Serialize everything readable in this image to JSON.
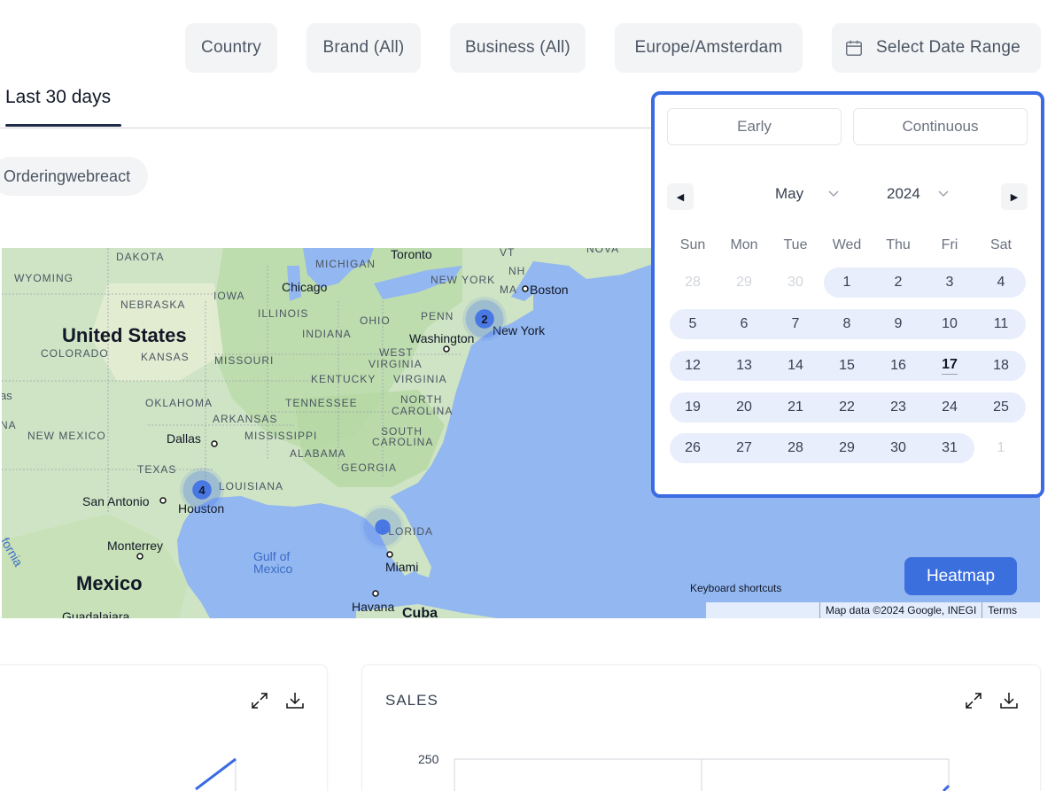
{
  "filters": {
    "country": "Country",
    "brand": "Brand (All)",
    "business": "Business (All)",
    "timezone": "Europe/Amsterdam",
    "date_range": "Select Date Range",
    "date_icon": "calendar-icon"
  },
  "tabs": [
    {
      "label": "Last 30 days",
      "active": true
    }
  ],
  "chip": {
    "label": "Orderingwebreact"
  },
  "map": {
    "regions": {
      "wyoming": "WYOMING",
      "dakota": "DAKOTA",
      "nebraska": "NEBRASKA",
      "iowa": "IOWA",
      "michigan": "MICHIGAN",
      "illinois": "ILLINOIS",
      "ohio": "OHIO",
      "indiana": "INDIANA",
      "penn": "PENN",
      "colorado": "COLORADO",
      "kansas": "KANSAS",
      "missouri": "MISSOURI",
      "west_virginia": "WEST VIRGINIA",
      "virginia": "VIRGINIA",
      "kentucky": "KENTUCKY",
      "oklahoma": "OKLAHOMA",
      "tennessee": "TENNESSEE",
      "arkansas": "ARKANSAS",
      "north_carolina": "NORTH CAROLINA",
      "new_mexico": "NEW MEXICO",
      "mississippi": "MISSISSIPPI",
      "south_carolina": "SOUTH CAROLINA",
      "alabama": "ALABAMA",
      "georgia": "GEORGIA",
      "texas": "TEXAS",
      "louisiana": "LOUISIANA",
      "florida": "FLORIDA",
      "new_york_state": "NEW YORK",
      "ma": "MA",
      "nh": "NH",
      "vt": "VT",
      "nova": "NOVA",
      "as": "as",
      "na": "NA"
    },
    "cities": {
      "toronto": "Toronto",
      "chicago": "Chicago",
      "boston": "Boston",
      "washington": "Washington",
      "new_york": "New York",
      "dallas": "Dallas",
      "san_antonio": "San Antonio",
      "houston": "Houston",
      "monterrey": "Monterrey",
      "miami": "Miami",
      "havana": "Havana",
      "cuba": "Cuba",
      "guadalajara": "Guadalajara"
    },
    "big_labels": {
      "united_states": "United States",
      "mexico": "Mexico"
    },
    "water": {
      "gulf_line1": "Gulf of",
      "gulf_line2": "Mexico",
      "california": "fornia"
    },
    "clusters": [
      {
        "name": "new-york",
        "count": "2"
      },
      {
        "name": "houston",
        "count": "4"
      },
      {
        "name": "florida",
        "count": ""
      }
    ],
    "heatmap_button": "Heatmap",
    "keyboard_shortcuts": "Keyboard shortcuts",
    "attribution": "Map data ©2024 Google, INEGI",
    "terms": "Terms"
  },
  "date_picker": {
    "modes": [
      "Early",
      "Continuous"
    ],
    "month": "May",
    "year": "2024",
    "weekdays": [
      "Sun",
      "Mon",
      "Tue",
      "Wed",
      "Thu",
      "Fri",
      "Sat"
    ],
    "weeks": [
      [
        "28",
        "29",
        "30",
        "1",
        "2",
        "3",
        "4"
      ],
      [
        "5",
        "6",
        "7",
        "8",
        "9",
        "10",
        "11"
      ],
      [
        "12",
        "13",
        "14",
        "15",
        "16",
        "17",
        "18"
      ],
      [
        "19",
        "20",
        "21",
        "22",
        "23",
        "24",
        "25"
      ],
      [
        "26",
        "27",
        "28",
        "29",
        "30",
        "31",
        "1"
      ]
    ],
    "today": "17"
  },
  "cards": [
    {
      "title": ""
    },
    {
      "title": "SALES",
      "y_tick": "250"
    }
  ],
  "colors": {
    "accent": "#3b6be3",
    "heatmap_button": "#3c6fde",
    "range_bg": "#e8eefc"
  }
}
